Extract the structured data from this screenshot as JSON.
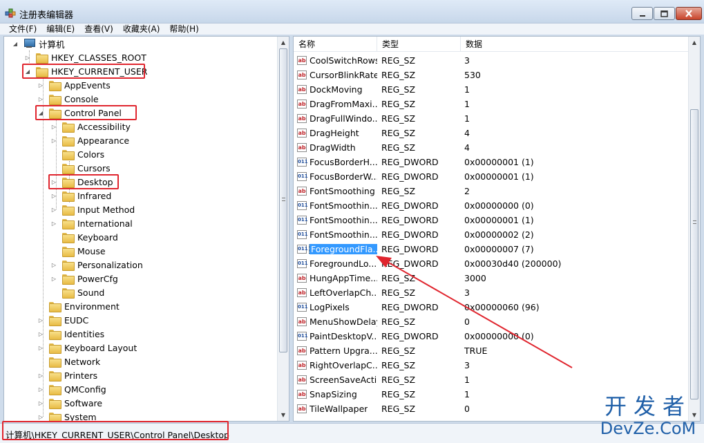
{
  "window": {
    "title": "注册表编辑器",
    "buttons": {
      "minimize": "─",
      "maximize": "□",
      "close": "✕"
    }
  },
  "menu": [
    "文件(F)",
    "编辑(E)",
    "查看(V)",
    "收藏夹(A)",
    "帮助(H)"
  ],
  "tree": {
    "root": "计算机",
    "nodes": [
      {
        "label": "HKEY_CLASSES_ROOT",
        "level": 1,
        "expander": "▷",
        "highlighted": false
      },
      {
        "label": "HKEY_CURRENT_USER",
        "level": 1,
        "expander": "◢",
        "highlighted": true
      },
      {
        "label": "AppEvents",
        "level": 2,
        "expander": "▷",
        "highlighted": false
      },
      {
        "label": "Console",
        "level": 2,
        "expander": "▷",
        "highlighted": false
      },
      {
        "label": "Control Panel",
        "level": 2,
        "expander": "◢",
        "highlighted": true
      },
      {
        "label": "Accessibility",
        "level": 3,
        "expander": "▷",
        "highlighted": false
      },
      {
        "label": "Appearance",
        "level": 3,
        "expander": "▷",
        "highlighted": false
      },
      {
        "label": "Colors",
        "level": 3,
        "expander": "",
        "highlighted": false
      },
      {
        "label": "Cursors",
        "level": 3,
        "expander": "",
        "highlighted": false
      },
      {
        "label": "Desktop",
        "level": 3,
        "expander": "▷",
        "highlighted": true
      },
      {
        "label": "Infrared",
        "level": 3,
        "expander": "▷",
        "highlighted": false
      },
      {
        "label": "Input Method",
        "level": 3,
        "expander": "▷",
        "highlighted": false
      },
      {
        "label": "International",
        "level": 3,
        "expander": "▷",
        "highlighted": false
      },
      {
        "label": "Keyboard",
        "level": 3,
        "expander": "",
        "highlighted": false
      },
      {
        "label": "Mouse",
        "level": 3,
        "expander": "",
        "highlighted": false
      },
      {
        "label": "Personalization",
        "level": 3,
        "expander": "▷",
        "highlighted": false
      },
      {
        "label": "PowerCfg",
        "level": 3,
        "expander": "▷",
        "highlighted": false
      },
      {
        "label": "Sound",
        "level": 3,
        "expander": "",
        "highlighted": false
      },
      {
        "label": "Environment",
        "level": 2,
        "expander": "",
        "highlighted": false
      },
      {
        "label": "EUDC",
        "level": 2,
        "expander": "▷",
        "highlighted": false
      },
      {
        "label": "Identities",
        "level": 2,
        "expander": "▷",
        "highlighted": false
      },
      {
        "label": "Keyboard Layout",
        "level": 2,
        "expander": "▷",
        "highlighted": false
      },
      {
        "label": "Network",
        "level": 2,
        "expander": "",
        "highlighted": false
      },
      {
        "label": "Printers",
        "level": 2,
        "expander": "▷",
        "highlighted": false
      },
      {
        "label": "QMConfig",
        "level": 2,
        "expander": "▷",
        "highlighted": false
      },
      {
        "label": "Software",
        "level": 2,
        "expander": "▷",
        "highlighted": false
      },
      {
        "label": "System",
        "level": 2,
        "expander": "▷",
        "highlighted": false
      }
    ]
  },
  "list": {
    "columns": [
      "名称",
      "类型",
      "数据"
    ],
    "rows": [
      {
        "icon": "string-value-icon",
        "name": "CoolSwitchRows",
        "type": "REG_SZ",
        "data": "3"
      },
      {
        "icon": "string-value-icon",
        "name": "CursorBlinkRate",
        "type": "REG_SZ",
        "data": "530"
      },
      {
        "icon": "string-value-icon",
        "name": "DockMoving",
        "type": "REG_SZ",
        "data": "1"
      },
      {
        "icon": "string-value-icon",
        "name": "DragFromMaxi...",
        "type": "REG_SZ",
        "data": "1"
      },
      {
        "icon": "string-value-icon",
        "name": "DragFullWindo...",
        "type": "REG_SZ",
        "data": "1"
      },
      {
        "icon": "string-value-icon",
        "name": "DragHeight",
        "type": "REG_SZ",
        "data": "4"
      },
      {
        "icon": "string-value-icon",
        "name": "DragWidth",
        "type": "REG_SZ",
        "data": "4"
      },
      {
        "icon": "dword-value-icon",
        "name": "FocusBorderH...",
        "type": "REG_DWORD",
        "data": "0x00000001 (1)"
      },
      {
        "icon": "dword-value-icon",
        "name": "FocusBorderW...",
        "type": "REG_DWORD",
        "data": "0x00000001 (1)"
      },
      {
        "icon": "string-value-icon",
        "name": "FontSmoothing",
        "type": "REG_SZ",
        "data": "2"
      },
      {
        "icon": "dword-value-icon",
        "name": "FontSmoothin...",
        "type": "REG_DWORD",
        "data": "0x00000000 (0)"
      },
      {
        "icon": "dword-value-icon",
        "name": "FontSmoothin...",
        "type": "REG_DWORD",
        "data": "0x00000001 (1)"
      },
      {
        "icon": "dword-value-icon",
        "name": "FontSmoothin...",
        "type": "REG_DWORD",
        "data": "0x00000002 (2)"
      },
      {
        "icon": "dword-value-icon",
        "name": "ForegroundFla...",
        "type": "REG_DWORD",
        "data": "0x00000007 (7)",
        "selected": true
      },
      {
        "icon": "dword-value-icon",
        "name": "ForegroundLo...",
        "type": "REG_DWORD",
        "data": "0x00030d40 (200000)"
      },
      {
        "icon": "string-value-icon",
        "name": "HungAppTime...",
        "type": "REG_SZ",
        "data": "3000"
      },
      {
        "icon": "string-value-icon",
        "name": "LeftOverlapCh...",
        "type": "REG_SZ",
        "data": "3"
      },
      {
        "icon": "dword-value-icon",
        "name": "LogPixels",
        "type": "REG_DWORD",
        "data": "0x00000060 (96)"
      },
      {
        "icon": "string-value-icon",
        "name": "MenuShowDelay",
        "type": "REG_SZ",
        "data": "0"
      },
      {
        "icon": "dword-value-icon",
        "name": "PaintDesktopV...",
        "type": "REG_DWORD",
        "data": "0x00000000 (0)"
      },
      {
        "icon": "string-value-icon",
        "name": "Pattern Upgra...",
        "type": "REG_SZ",
        "data": "TRUE"
      },
      {
        "icon": "string-value-icon",
        "name": "RightOverlapC...",
        "type": "REG_SZ",
        "data": "3"
      },
      {
        "icon": "string-value-icon",
        "name": "ScreenSaveActi...",
        "type": "REG_SZ",
        "data": "1"
      },
      {
        "icon": "string-value-icon",
        "name": "SnapSizing",
        "type": "REG_SZ",
        "data": "1"
      },
      {
        "icon": "string-value-icon",
        "name": "TileWallpaper",
        "type": "REG_SZ",
        "data": "0"
      }
    ]
  },
  "statusbar": {
    "path": "计算机\\HKEY_CURRENT_USER\\Control Panel\\Desktop"
  },
  "watermark": {
    "line1": "开发者",
    "line2": "DevZe.CoM"
  },
  "colors": {
    "highlight_box": "#e0252e",
    "selection": "#3399ff",
    "arrow": "#e0252e"
  }
}
